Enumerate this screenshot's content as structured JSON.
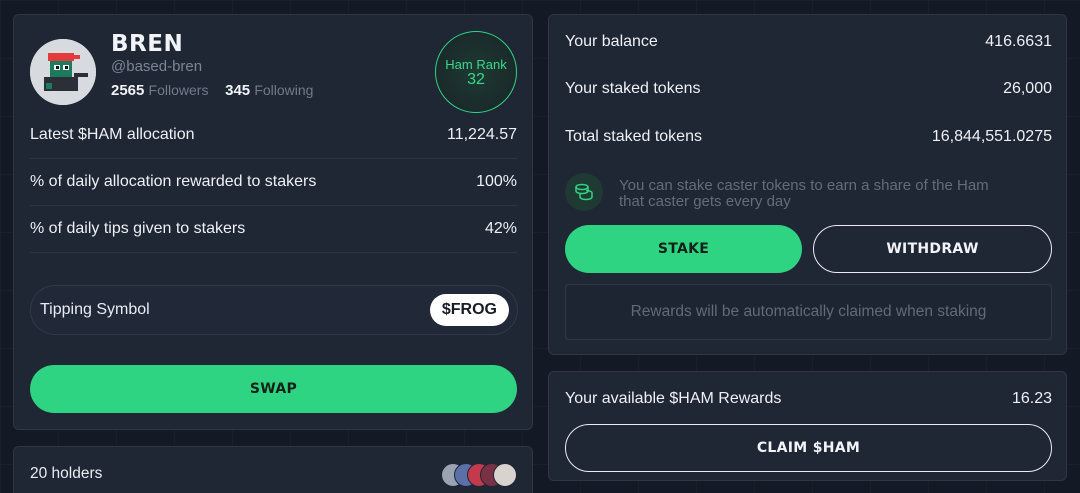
{
  "profile": {
    "name": "BREN",
    "handle": "@based-bren",
    "followers_count": "2565",
    "followers_label": "Followers",
    "following_count": "345",
    "following_label": "Following",
    "rank_label": "Ham Rank",
    "rank_value": "32"
  },
  "stats": [
    {
      "label": "Latest $HAM allocation",
      "value": "11,224.57"
    },
    {
      "label": "% of daily allocation rewarded to stakers",
      "value": "100%"
    },
    {
      "label": "% of daily tips given to stakers",
      "value": "42%"
    }
  ],
  "tipping": {
    "label": "Tipping Symbol",
    "symbol": "$FROG"
  },
  "swap_label": "SWAP",
  "holders": {
    "label": "20 holders"
  },
  "staking": {
    "balance_label": "Your balance",
    "balance_value": "416.6631",
    "staked_label": "Your staked tokens",
    "staked_value": "26,000",
    "total_label": "Total staked tokens",
    "total_value": "16,844,551.0275",
    "info_text_line1": "You can stake caster tokens to earn a share of the Ham",
    "info_text_line2": "that caster gets every day",
    "stake_label": "STAKE",
    "withdraw_label": "WITHDRAW",
    "auto_claim_text": "Rewards will be automatically claimed when staking"
  },
  "rewards": {
    "label": "Your available $HAM Rewards",
    "value": "16.23",
    "claim_label": "CLAIM $HAM"
  },
  "colors": {
    "accent": "#2fd483",
    "background": "#141a25",
    "card": "#1f2634"
  },
  "icons": {
    "avatar": "pixel-frog-avatar",
    "info": "coins-icon"
  }
}
